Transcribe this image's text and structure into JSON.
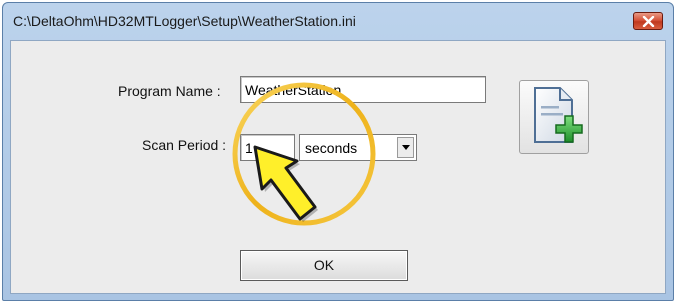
{
  "window": {
    "title": "C:\\DeltaOhm\\HD32MTLogger\\Setup\\WeatherStation.ini"
  },
  "form": {
    "program_name_label": "Program Name :",
    "program_name_value": "WeatherStation",
    "scan_period_label": "Scan Period :",
    "scan_period_value": "1",
    "scan_period_unit": "seconds"
  },
  "buttons": {
    "ok_label": "OK"
  },
  "icons": {
    "close": "close-icon",
    "new_file": "new-file-add-icon",
    "dropdown": "chevron-down-icon",
    "pointer": "arrow-pointer-icon"
  },
  "colors": {
    "title_bar": "#b4cce8",
    "close_button": "#c9452a",
    "highlight_ring": "#f1b91e",
    "pointer_fill": "#ffef2a",
    "add_badge": "#32a832"
  }
}
